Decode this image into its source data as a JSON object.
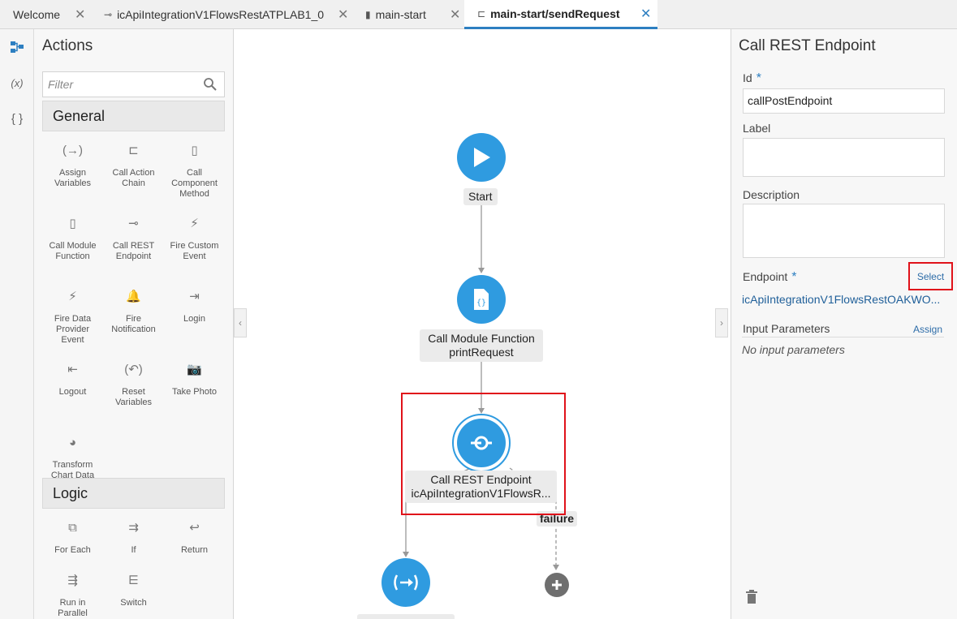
{
  "tabs": [
    {
      "label": "Welcome",
      "close": "✕"
    },
    {
      "label": "icApiIntegrationV1FlowsRestATPLAB1_0",
      "close": "✕"
    },
    {
      "label": "main-start",
      "close": "✕"
    },
    {
      "label": "main-start/sendRequest",
      "close": "✕"
    }
  ],
  "rail": {
    "flow_icon": "flow-diagram-icon",
    "variables": "(x)",
    "json": "{ }"
  },
  "actions": {
    "title": "Actions",
    "filter_placeholder": "Filter",
    "general": {
      "title": "General",
      "items": [
        {
          "label": "Assign\nVariables",
          "icon": "assign-variables-icon",
          "glyph": "(→)"
        },
        {
          "label": "Call Action\nChain",
          "icon": "call-action-chain-icon",
          "glyph": "⊏"
        },
        {
          "label": "Call\nComponent\nMethod",
          "icon": "call-component-method-icon",
          "glyph": "▯"
        },
        {
          "label": "Call Module\nFunction",
          "icon": "call-module-function-icon",
          "glyph": "▯"
        },
        {
          "label": "Call REST\nEndpoint",
          "icon": "call-rest-endpoint-icon",
          "glyph": "⊸"
        },
        {
          "label": "Fire Custom\nEvent",
          "icon": "fire-custom-event-icon",
          "glyph": "⚡"
        },
        {
          "label": "Fire Data\nProvider\nEvent",
          "icon": "fire-data-provider-event-icon",
          "glyph": "⚡"
        },
        {
          "label": "Fire\nNotification",
          "icon": "bell-icon",
          "glyph": "🔔"
        },
        {
          "label": "Login",
          "icon": "login-icon",
          "glyph": "⇥"
        },
        {
          "label": "Logout",
          "icon": "logout-icon",
          "glyph": "⇤"
        },
        {
          "label": "Reset\nVariables",
          "icon": "reset-variables-icon",
          "glyph": "(↶)"
        },
        {
          "label": "Take Photo",
          "icon": "camera-icon",
          "glyph": "📷"
        },
        {
          "label": "Transform\nChart Data",
          "icon": "pie-chart-icon",
          "glyph": "◕"
        }
      ]
    },
    "logic": {
      "title": "Logic",
      "items": [
        {
          "label": "For Each",
          "icon": "for-each-icon",
          "glyph": "⧉"
        },
        {
          "label": "If",
          "icon": "if-icon",
          "glyph": "⇉"
        },
        {
          "label": "Return",
          "icon": "return-icon",
          "glyph": "↩"
        },
        {
          "label": "Run in\nParallel",
          "icon": "run-in-parallel-icon",
          "glyph": "⇶"
        },
        {
          "label": "Switch",
          "icon": "switch-icon",
          "glyph": "⋿"
        }
      ]
    }
  },
  "canvas": {
    "left_handle": "‹",
    "right_handle": "›",
    "start_label": "Start",
    "module_label_1": "Call Module Function",
    "module_label_2": "printRequest",
    "rest_label_1": "Call REST Endpoint",
    "rest_label_2": "icApiIntegrationV1FlowsR...",
    "failure_label": "failure"
  },
  "props": {
    "title": "Call REST Endpoint",
    "id_label": "Id",
    "id_value": "callPostEndpoint",
    "label_label": "Label",
    "label_value": "",
    "description_label": "Description",
    "description_value": "",
    "endpoint_label": "Endpoint",
    "select_link": "Select",
    "endpoint_value": "icApiIntegrationV1FlowsRestOAKWO...",
    "input_params_label": "Input Parameters",
    "assign_link": "Assign",
    "no_params": "No input parameters",
    "required_mark": "*"
  },
  "colors": {
    "accent": "#2f9be0",
    "highlight": "#e0121a",
    "link": "#2d6ca8"
  }
}
